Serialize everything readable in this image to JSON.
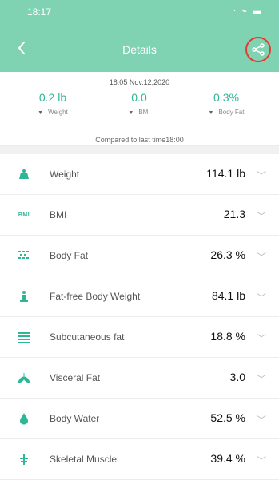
{
  "status_bar": {
    "time": "18:17",
    "icons": "⋅ ⌁ ▬"
  },
  "header": {
    "title": "Details",
    "back_icon": "chevron-left",
    "share_icon": "share"
  },
  "summary": {
    "timestamp": "18:05 Nov.12,2020",
    "metrics": [
      {
        "value": "0.2 lb",
        "label": "Weight"
      },
      {
        "value": "0.0",
        "label": "BMI"
      },
      {
        "value": "0.3%",
        "label": "Body Fat"
      }
    ],
    "compare_text": "Compared to last time18:00"
  },
  "list": [
    {
      "name": "Weight",
      "value": "114.1 lb",
      "icon": "weight-icon"
    },
    {
      "name": "BMI",
      "value": "21.3",
      "icon": "bmi-icon",
      "icon_text": "BMI"
    },
    {
      "name": "Body Fat",
      "value": "26.3 %",
      "icon": "body-fat-icon"
    },
    {
      "name": "Fat-free Body Weight",
      "value": "84.1 lb",
      "icon": "fat-free-weight-icon"
    },
    {
      "name": "Subcutaneous fat",
      "value": "18.8 %",
      "icon": "subcutaneous-fat-icon"
    },
    {
      "name": "Visceral Fat",
      "value": "3.0",
      "icon": "visceral-fat-icon"
    },
    {
      "name": "Body Water",
      "value": "52.5 %",
      "icon": "body-water-icon"
    },
    {
      "name": "Skeletal Muscle",
      "value": "39.4 %",
      "icon": "skeletal-muscle-icon"
    }
  ],
  "colors": {
    "header_bg": "#7fd3b2",
    "accent": "#2fb795",
    "highlight": "#e53b2f"
  }
}
